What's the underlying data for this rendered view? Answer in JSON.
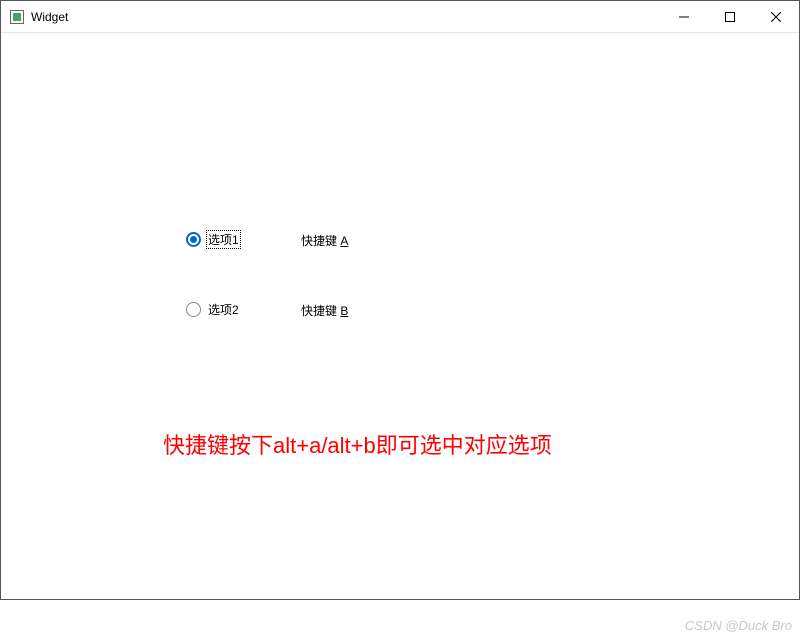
{
  "window": {
    "title": "Widget"
  },
  "radios": {
    "option1": {
      "label": "选项1",
      "checked": true
    },
    "option2": {
      "label": "选项2",
      "checked": false
    }
  },
  "shortcuts": {
    "a": {
      "prefix": "快捷键 ",
      "mnemonic": "A"
    },
    "b": {
      "prefix": "快捷键 ",
      "mnemonic": "B"
    }
  },
  "hint": "快捷键按下alt+a/alt+b即可选中对应选项",
  "watermark": "CSDN @Duck Bro"
}
